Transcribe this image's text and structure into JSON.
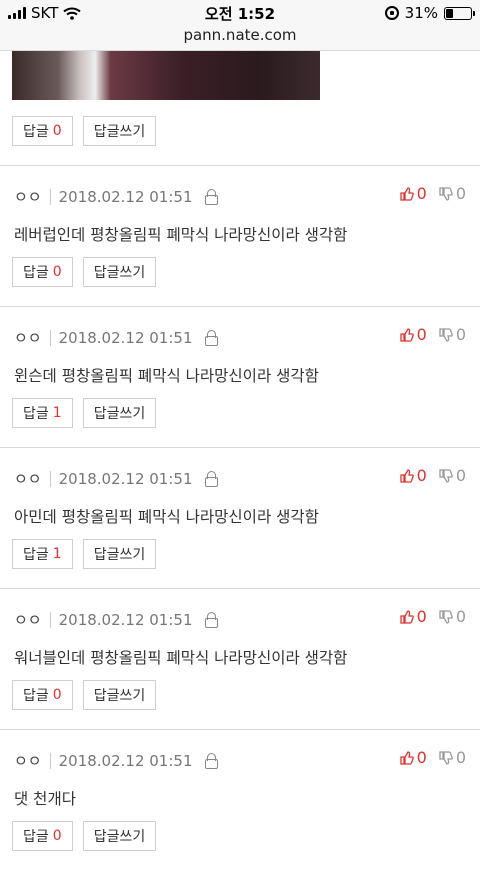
{
  "status_bar": {
    "carrier": "SKT",
    "time": "오전 1:52",
    "url": "pann.nate.com",
    "battery": "31%",
    "battery_level": 0.31
  },
  "first_actions": {
    "reply_label": "답글",
    "reply_count": "0",
    "write_label": "답글쓰기"
  },
  "comments": [
    {
      "author": "ㅇㅇ",
      "date": "2018.02.12 01:51",
      "up": "0",
      "down": "0",
      "text": "레버럽인데 평창올림픽 폐막식 나라망신이라 생각함",
      "reply_label": "답글",
      "reply_count": "0",
      "write_label": "답글쓰기"
    },
    {
      "author": "ㅇㅇ",
      "date": "2018.02.12 01:51",
      "up": "0",
      "down": "0",
      "text": "윈슨데 평창올림픽 폐막식 나라망신이라 생각함",
      "reply_label": "답글",
      "reply_count": "1",
      "write_label": "답글쓰기"
    },
    {
      "author": "ㅇㅇ",
      "date": "2018.02.12 01:51",
      "up": "0",
      "down": "0",
      "text": "아민데 평창올림픽 폐막식 나라망신이라 생각함",
      "reply_label": "답글",
      "reply_count": "1",
      "write_label": "답글쓰기"
    },
    {
      "author": "ㅇㅇ",
      "date": "2018.02.12 01:51",
      "up": "0",
      "down": "0",
      "text": "워너블인데 평창올림픽 폐막식 나라망신이라 생각함",
      "reply_label": "답글",
      "reply_count": "0",
      "write_label": "답글쓰기"
    },
    {
      "author": "ㅇㅇ",
      "date": "2018.02.12 01:51",
      "up": "0",
      "down": "0",
      "text": "댓 천개다",
      "reply_label": "답글",
      "reply_count": "0",
      "write_label": "답글쓰기"
    }
  ],
  "colors": {
    "accent": "#e0322f",
    "muted": "#999999",
    "border": "#d8d8d8"
  }
}
